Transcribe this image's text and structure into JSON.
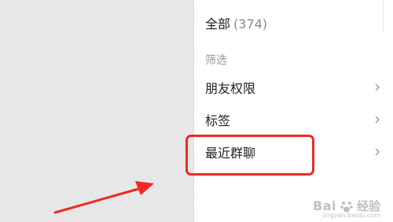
{
  "menu": {
    "all": {
      "label": "全部",
      "count": "(374)"
    },
    "filter_section_title": "筛选",
    "items": [
      {
        "label": "朋友权限",
        "icon": "chevron-right-icon"
      },
      {
        "label": "标签",
        "icon": "chevron-right-icon"
      },
      {
        "label": "最近群聊",
        "icon": "chevron-right-icon"
      }
    ]
  },
  "annotation": {
    "highlight_color": "#ee2a22",
    "arrow_color": "#ee2a22"
  },
  "watermark": {
    "logo": "Bai",
    "text": "经验",
    "sub": "jingyan.baidu.com"
  }
}
